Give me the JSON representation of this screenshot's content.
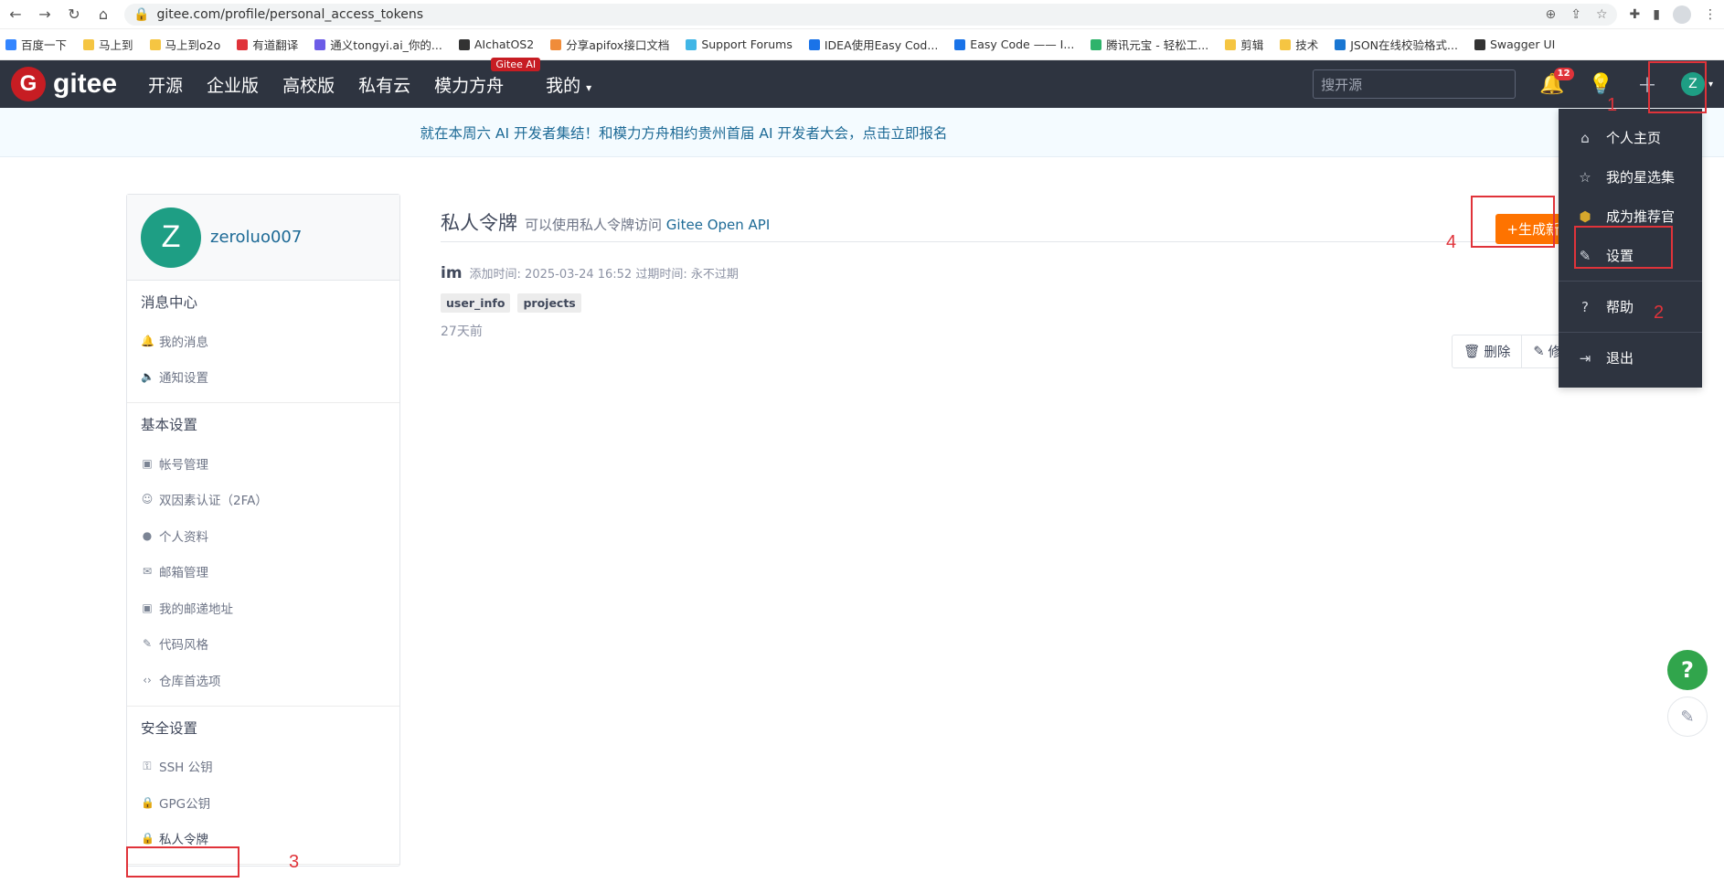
{
  "browser": {
    "url": "gitee.com/profile/personal_access_tokens",
    "bookmarks": [
      {
        "label": "百度一下",
        "color": "#3385ff"
      },
      {
        "label": "马上到",
        "color": "#f5c542"
      },
      {
        "label": "马上到o2o",
        "color": "#f5c542"
      },
      {
        "label": "有道翻译",
        "color": "#e0333a"
      },
      {
        "label": "通义tongyi.ai_你的...",
        "color": "#6c5ce7"
      },
      {
        "label": "AIchatOS2",
        "color": "#333333"
      },
      {
        "label": "分享apifox接口文档",
        "color": "#f08c3a"
      },
      {
        "label": "Support Forums",
        "color": "#41b6e6"
      },
      {
        "label": "IDEA使用Easy Cod...",
        "color": "#1a73e8"
      },
      {
        "label": "Easy Code —— I...",
        "color": "#1a73e8"
      },
      {
        "label": "腾讯元宝 - 轻松工...",
        "color": "#2fb36b"
      },
      {
        "label": "剪辑",
        "color": "#f5c542"
      },
      {
        "label": "技术",
        "color": "#f5c542"
      },
      {
        "label": "JSON在线校验格式...",
        "color": "#1976d2"
      },
      {
        "label": "Swagger UI",
        "color": "#333333"
      }
    ]
  },
  "topnav": {
    "logo": "gitee",
    "links": [
      "开源",
      "企业版",
      "高校版",
      "私有云",
      "模力方舟",
      "我的"
    ],
    "ai_badge": "Gitee AI",
    "search_placeholder": "搜开源",
    "notifications": "12",
    "user_initial": "Z"
  },
  "banner": "就在本周六 AI 开发者集结！和模力方舟相约贵州首届 AI 开发者大会，点击立即报名",
  "profile": {
    "initial": "Z",
    "name": "zeroluo007"
  },
  "sidebar": {
    "sections": [
      {
        "title": "消息中心",
        "items": [
          {
            "label": "我的消息",
            "icon": "bell-icon",
            "glyph": "🔔"
          },
          {
            "label": "通知设置",
            "icon": "speaker-icon",
            "glyph": "🔈"
          }
        ]
      },
      {
        "title": "基本设置",
        "items": [
          {
            "label": "帐号管理",
            "icon": "id-card-icon",
            "glyph": "▣"
          },
          {
            "label": "双因素认证（2FA）",
            "icon": "user-key-icon",
            "glyph": "☺"
          },
          {
            "label": "个人资料",
            "icon": "user-icon",
            "glyph": "●"
          },
          {
            "label": "邮箱管理",
            "icon": "mail-icon",
            "glyph": "✉"
          },
          {
            "label": "我的邮递地址",
            "icon": "address-icon",
            "glyph": "▣"
          },
          {
            "label": "代码风格",
            "icon": "brush-icon",
            "glyph": "✎"
          },
          {
            "label": "仓库首选项",
            "icon": "code-icon",
            "glyph": "‹›"
          }
        ]
      },
      {
        "title": "安全设置",
        "items": [
          {
            "label": "SSH 公钥",
            "icon": "key-icon",
            "glyph": "⚿"
          },
          {
            "label": "GPG公钥",
            "icon": "lock-icon",
            "glyph": "🔒"
          },
          {
            "label": "私人令牌",
            "icon": "token-lock-icon",
            "glyph": "🔒"
          }
        ]
      }
    ]
  },
  "main": {
    "title": "私人令牌",
    "subtitle_prefix": "可以使用私人令牌访问",
    "subtitle_link": "Gitee Open API",
    "generate_label": "+生成新",
    "token": {
      "name": "im",
      "meta": "添加时间: 2025-03-24 16:52   过期时间: 永不过期",
      "tags": [
        "user_info",
        "projects"
      ],
      "time_ago": "27天前"
    },
    "delete_label": "删除",
    "edit_label": "修"
  },
  "dropdown": {
    "items": [
      {
        "label": "个人主页",
        "icon": "home-icon",
        "glyph": "⌂"
      },
      {
        "label": "我的星选集",
        "icon": "star-icon",
        "glyph": "☆"
      },
      {
        "label": "成为推荐官",
        "icon": "badge-icon",
        "glyph": "⬢"
      },
      {
        "label": "设置",
        "icon": "edit-icon",
        "glyph": "✎"
      },
      {
        "label": "帮助",
        "icon": "question-icon",
        "glyph": "?"
      },
      {
        "label": "退出",
        "icon": "logout-icon",
        "glyph": "⇥"
      }
    ]
  },
  "steps": [
    "1",
    "2",
    "3",
    "4"
  ]
}
